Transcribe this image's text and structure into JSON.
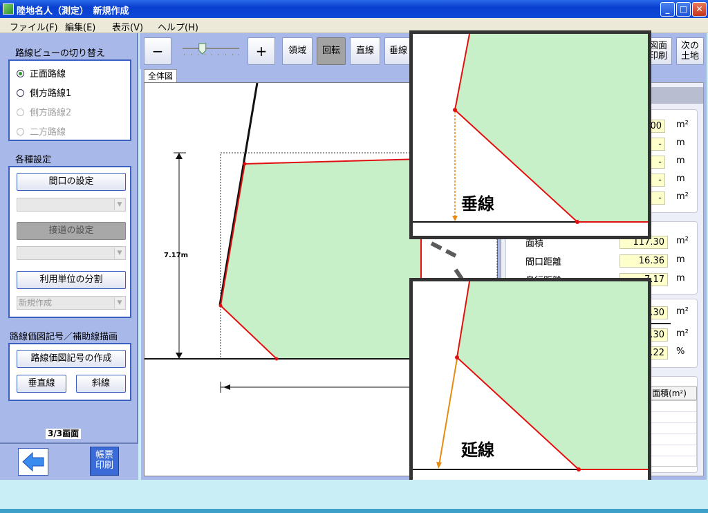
{
  "window": {
    "title": "陸地名人（測定）　新規作成",
    "minimize": "_",
    "maximize": "□",
    "close": "✕"
  },
  "menu": {
    "items": [
      "ファイル(F)",
      "編集(E)",
      "表示(V)",
      "ヘルプ(H)"
    ]
  },
  "left": {
    "view_title": "路線ビューの切り替え",
    "views": [
      {
        "label": "正面路線",
        "selected": true,
        "enabled": true
      },
      {
        "label": "側方路線1",
        "selected": false,
        "enabled": true
      },
      {
        "label": "側方路線2",
        "selected": false,
        "enabled": false
      },
      {
        "label": "二方路線",
        "selected": false,
        "enabled": false
      }
    ],
    "settings_title": "各種設定",
    "frontage_btn": "間口の設定",
    "road_btn": "接道の設定",
    "split_btn": "利用単位の分割",
    "split_combo": "新規作成",
    "symbol_title": "路線価図記号／補助線描画",
    "symbol_btn": "路線価図記号の作成",
    "vertical_btn": "垂直線",
    "oblique_btn": "斜線",
    "page_indicator": "3/3画面",
    "print_btn": "帳票印刷"
  },
  "toolbar": {
    "zoom_out": "−",
    "zoom_in": "+",
    "zoom_level": 0.35,
    "area": "領域",
    "rotate": "回転",
    "straight": "直線",
    "perpendicular": "垂線",
    "print_drawing": "図面印刷",
    "next_land": "次の土地"
  },
  "canvas": {
    "tab": "全体図",
    "dimension": "7.17m"
  },
  "right": {
    "top_values": [
      {
        "value": "0.00",
        "unit": "m²"
      },
      {
        "value": "-",
        "unit": "m"
      },
      {
        "value": "-",
        "unit": "m"
      },
      {
        "value": "-",
        "unit": "m"
      },
      {
        "value": "-",
        "unit": "m²"
      }
    ],
    "rows": [
      {
        "label": "面積",
        "value": "117.30",
        "unit": "m²"
      },
      {
        "label": "間口距離",
        "value": "16.36",
        "unit": "m"
      },
      {
        "label": "奥行距離",
        "value": "7.17",
        "unit": "m"
      }
    ],
    "lower_values": [
      {
        "value": ".30",
        "unit": "m²"
      },
      {
        "value": ".30",
        "unit": "m²"
      },
      {
        "value": ".22",
        "unit": "%"
      }
    ],
    "table_header": "面積(m²)"
  },
  "callouts": {
    "top_label": "垂線",
    "bottom_label": "延線"
  },
  "colors": {
    "accent": "#3c5fc2",
    "parcel_fill": "#c8f0c8",
    "parcel_edge": "#e01010",
    "guide": "#e88a10"
  }
}
